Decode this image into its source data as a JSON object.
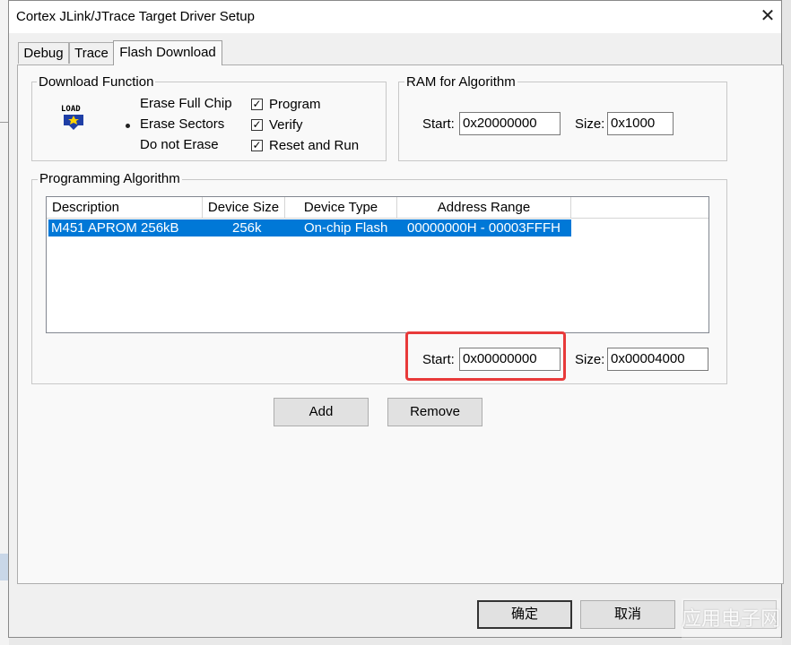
{
  "window": {
    "title": "Cortex JLink/JTrace Target Driver Setup",
    "close_glyph": "✕"
  },
  "tabs": [
    {
      "label": "Debug",
      "active": false
    },
    {
      "label": "Trace",
      "active": false
    },
    {
      "label": "Flash Download",
      "active": true
    }
  ],
  "download_function": {
    "legend": "Download Function",
    "icon_text": "LOAD",
    "erase_options": [
      {
        "label": "Erase Full Chip",
        "selected": false
      },
      {
        "label": "Erase Sectors",
        "selected": true
      },
      {
        "label": "Do not Erase",
        "selected": false
      }
    ],
    "checkboxes": [
      {
        "label": "Program",
        "checked": true
      },
      {
        "label": "Verify",
        "checked": true
      },
      {
        "label": "Reset and Run",
        "checked": true
      }
    ]
  },
  "ram_for_algorithm": {
    "legend": "RAM for Algorithm",
    "start_label": "Start:",
    "start_value": "0x20000000",
    "size_label": "Size:",
    "size_value": "0x1000"
  },
  "programming_algorithm": {
    "legend": "Programming Algorithm",
    "columns": [
      "Description",
      "Device Size",
      "Device Type",
      "Address Range"
    ],
    "rows": [
      {
        "description": "M451 APROM 256kB",
        "device_size": "256k",
        "device_type": "On-chip Flash",
        "address_range": "00000000H - 00003FFFH",
        "selected": true
      }
    ],
    "start_label": "Start:",
    "start_value": "0x00000000",
    "size_label": "Size:",
    "size_value": "0x00004000"
  },
  "buttons": {
    "add": "Add",
    "remove": "Remove",
    "ok": "确定",
    "cancel": "取消"
  },
  "watermark": "应用电子网",
  "colors": {
    "selection": "#0078d7",
    "highlight_box": "#e83a3a"
  }
}
